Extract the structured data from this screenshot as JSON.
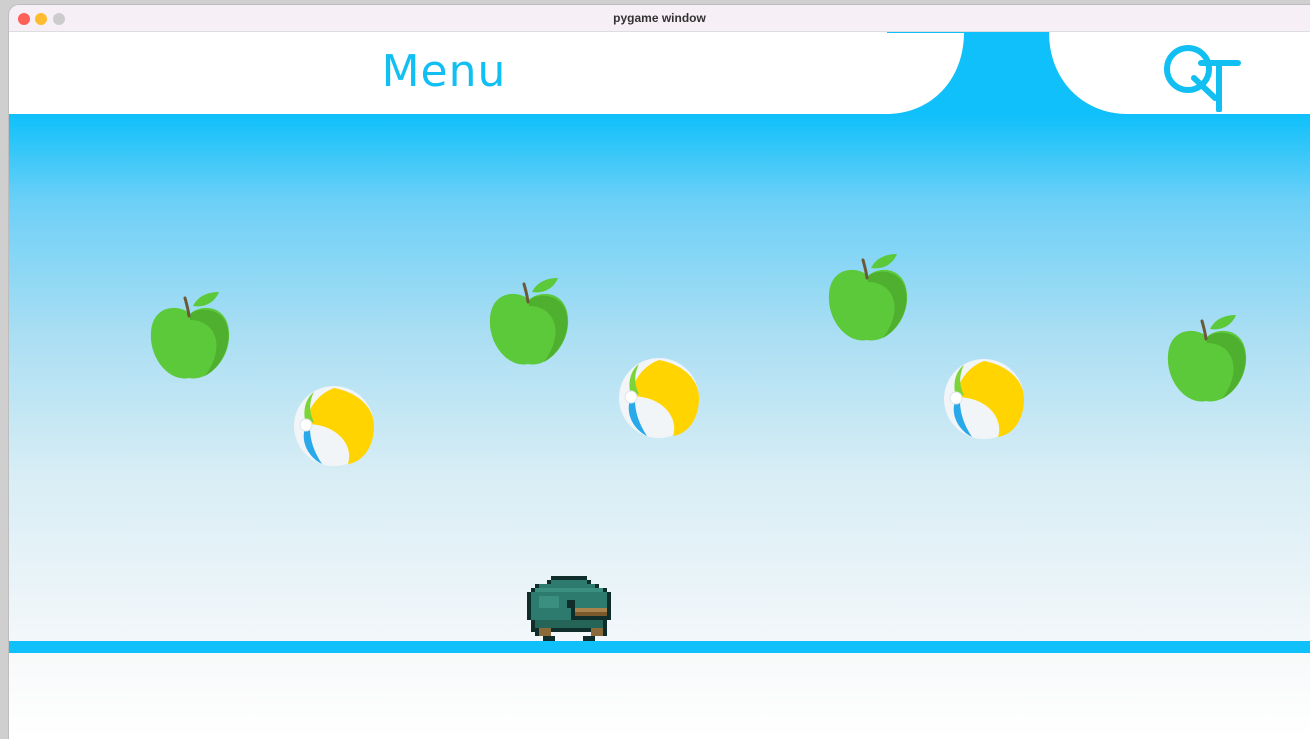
{
  "window": {
    "title": "pygame window"
  },
  "menu": {
    "label": "Menu"
  },
  "logo": {
    "icon": "qt-logo-icon"
  },
  "colors": {
    "accent": "#0fc0fa",
    "apple": "#5cc93a",
    "ball_yellow": "#ffd400"
  },
  "sprites": {
    "apples": 4,
    "balls": 3,
    "player": "pixel-duck-player"
  }
}
